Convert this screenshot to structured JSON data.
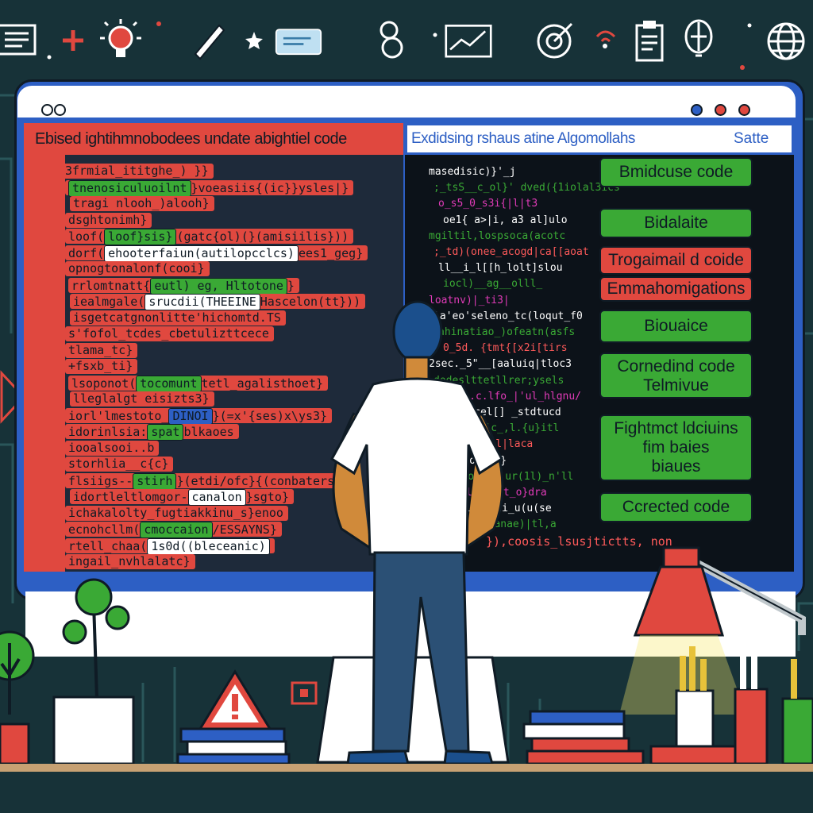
{
  "left_panel": {
    "title": "Ebised ightihmnobodees undate abightiel code",
    "lines": [
      {
        "text": "3frmial_ititghe_) }}"
      },
      {
        "pre": "",
        "hl": "tnenosiculuoilnt",
        "post": "}voeasiis{(ic}}ysles|}"
      },
      {
        "text": "tragi nlooh_)alooh}"
      },
      {
        "text": "dsghtonimh}"
      },
      {
        "pre": "loof(",
        "hl": "loof}sis}",
        "post": "(gatc{ol)(}(amisiilis}))"
      },
      {
        "pre": "dorf(",
        "hl": "ehooterfaiun(autilopcclcs)",
        "post": "ees1_geg}"
      },
      {
        "text": "opnogtonalonf(cooi}"
      },
      {
        "pre": "rrlomtnatt{",
        "hl": "eutl) eg, Hltotone",
        "post": "}"
      },
      {
        "pre": "iealmgale(",
        "hl": "srucdii(THEEINE",
        "post": "Hascelon(tt}))"
      },
      {
        "text": "isgetcatgnonlitte'hichomtd.TS"
      },
      {
        "text": "s'fofol_tcdes_cbetulizttcece"
      },
      {
        "text": "tlama_tc}"
      },
      {
        "text": "+fsxb_ti}"
      },
      {
        "pre": "lsoponot(",
        "hl": "tocomunt",
        "post": "tetl_agalisthoet}"
      },
      {
        "text": "lleglalgt eisizts3}"
      },
      {
        "pre": "iorl'lmestoto_",
        "hl": "DINOI",
        "post": "}(=x'{ses)x\\ys3}"
      },
      {
        "pre": "idorinlsia:",
        "hl": "spat",
        "post": "blkaoes"
      },
      {
        "text": "iooalsooi..b"
      },
      {
        "text": "storhlia__c{c}"
      },
      {
        "pre": "flsiigs--",
        "hl": "stirh",
        "post": "}(etdi/ofc}{(conbaters"
      },
      {
        "pre": "idortleltlomgor-",
        "hl": "canalon",
        "post": "}sgto}"
      },
      {
        "text": "ichakalolty_fugtiakkinu_s}enoo"
      },
      {
        "pre": "ecnohcllm(",
        "hl": "cmoccaion",
        "post": "/ESSAYNS}"
      },
      {
        "pre": "rtell_chaa(",
        "hl": "1s0d((bleceanic)",
        "post": ""
      },
      {
        "text": "ingail_nvhlalatc}"
      }
    ]
  },
  "right_panel": {
    "title": "Exdidsing rshaus atine Algomollahs",
    "save": "Satte",
    "lines": [
      "masedisic)}'_j",
      ";_tsS__c_ol}' dved({1iolal3ics",
      "o_s5_0_s3i{|l|t3",
      "oe1{ a>|i, a3 al]ulo",
      "mgiltil,lospsoca(acotc",
      ";_td)(onee_acogd|ca[[aoat",
      "ll__i_l[[h_lolt]slou",
      "iocl)__ag__olll_",
      "loatnv)|_ti3|",
      "la'eo'seleno_tc(loqut_f0",
      "ahinatiao_)ofeatn(asfs",
      "0_5d. {tmt{[x2i[tirs",
      "2sec._5\"__[aaluiq|tloc3",
      "dodeslttetllrer;ysels",
      "_0ilo.c.lfo_|'ul_hlgnu/",
      ";,s_fcel[] _stdtucd",
      "i:_i_oenuic_,l.{u}itl",
      "-|_,1[tdcel|laca",
      "lnl_oodlco}",
      "i_ecol|is|ur(1l)_n'll",
      ";l_sstlbogtlt_o}dra",
      "tl.[_i(;|xti_u(u(se",
      "u_anelo_(anae)|tl,a",
      "}),coosis_lsusjtictts, non"
    ]
  },
  "badges": [
    {
      "label": "Bmidcuse code",
      "color": "#3aa935"
    },
    {
      "label": "Bidalaite",
      "color": "#3aa935"
    },
    {
      "label": "Trogaimail d coide",
      "color": "#e0483f"
    },
    {
      "label": "Emmahomigations",
      "color": "#e0483f"
    },
    {
      "label": "Biouaice",
      "color": "#3aa935"
    },
    {
      "label": "Cornedind code\nTelmivue",
      "color": "#3aa935"
    },
    {
      "label": "Fightmct ldciuins\nfim baies\nbiaues",
      "color": "#3aa935"
    },
    {
      "label": "Ccrected code",
      "color": "#3aa935"
    }
  ],
  "colors": {
    "red": "#e0483f",
    "green": "#3aa935",
    "blue": "#2d5fc4",
    "dark": "#0f1b25",
    "bg": "#173238"
  },
  "icons": [
    "list-icon",
    "plus-icon",
    "lightbulb-icon",
    "pen-icon",
    "star-icon",
    "card-icon",
    "figure-eight-icon",
    "line-chart-icon",
    "target-icon",
    "wifi-icon",
    "clipboard-icon",
    "balloon-icon",
    "globe-icon"
  ]
}
